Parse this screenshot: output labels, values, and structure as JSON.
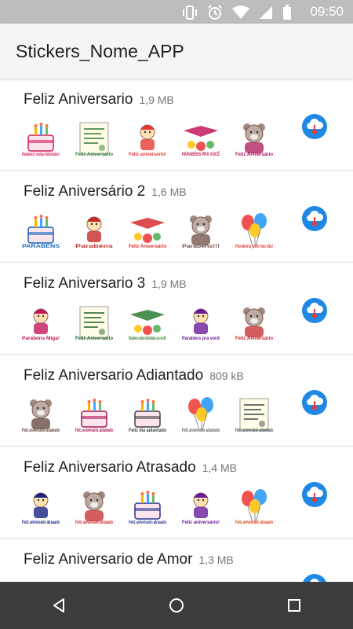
{
  "status": {
    "time": "09:50"
  },
  "app": {
    "title": "Stickers_Nome_APP"
  },
  "packs": [
    {
      "name": "Feliz Aniversario",
      "size": "1,9 MB",
      "stickers": [
        {
          "type": "cake",
          "text": "Parabéns!! muitas felicidades!",
          "color": "#d81b60"
        },
        {
          "type": "card",
          "text": "Feliz Aniversário",
          "color": "#2e7d32"
        },
        {
          "type": "character",
          "text": "Feliz aniversário!",
          "color": "#e53935"
        },
        {
          "type": "banner",
          "text": "PARABÉNS PRA VOCÊ",
          "color": "#c2185b"
        },
        {
          "type": "bear",
          "text": "Feliz Aniversário",
          "color": "#ad1457"
        }
      ]
    },
    {
      "name": "Feliz Aniversário 2",
      "size": "1,6 MB",
      "stickers": [
        {
          "type": "cake",
          "text": "PARABÉNS",
          "color": "#1565c0"
        },
        {
          "type": "character",
          "text": "Parabéns",
          "color": "#c62828"
        },
        {
          "type": "banner",
          "text": "Feliz Aniversário",
          "color": "#d32f2f"
        },
        {
          "type": "bear",
          "text": "Parabéns!!!",
          "color": "#6d4c41"
        },
        {
          "type": "balloon",
          "text": "Parabéns pelo teu dia!",
          "color": "#e53935"
        }
      ]
    },
    {
      "name": "Feliz Aniversario 3",
      "size": "1,9 MB",
      "stickers": [
        {
          "type": "character",
          "text": "Parabéns Miga!",
          "color": "#c2185b"
        },
        {
          "type": "card",
          "text": "Feliz Aniversário",
          "color": "#1b5e20"
        },
        {
          "type": "banner",
          "text": "Parabéns muitas felicidades pra você!!",
          "color": "#2e7d32"
        },
        {
          "type": "character",
          "text": "Parabéns pra você",
          "color": "#6a1b9a"
        },
        {
          "type": "bear",
          "text": "Feliz Aniversário",
          "color": "#c62828"
        }
      ]
    },
    {
      "name": "Feliz Aniversario Adiantado",
      "size": "809 kB",
      "stickers": [
        {
          "type": "bear",
          "text": "Feliz aniversário adiantado",
          "color": "#5d4037"
        },
        {
          "type": "cake",
          "text": "Feliz aniversário adiantado",
          "color": "#ad1457"
        },
        {
          "type": "cake",
          "text": "Feliz dia adiantado",
          "color": "#424242"
        },
        {
          "type": "balloon",
          "text": "Feliz aniversário adiantado",
          "color": "#616161"
        },
        {
          "type": "card",
          "text": "Feliz aniversário adiantado",
          "color": "#37474f"
        }
      ]
    },
    {
      "name": "Feliz Aniversario Atrasado",
      "size": "1,4 MB",
      "stickers": [
        {
          "type": "character",
          "text": "Feliz aniversário atrasado",
          "color": "#1a237e"
        },
        {
          "type": "bear",
          "text": "Feliz aniversário atrasado",
          "color": "#c62828"
        },
        {
          "type": "cake",
          "text": "Feliz aniversário atrasado",
          "color": "#283593"
        },
        {
          "type": "character",
          "text": "Feliz aniversário!",
          "color": "#6a1b9a"
        },
        {
          "type": "balloon",
          "text": "Feliz aniversário atrasado",
          "color": "#d84315"
        }
      ]
    },
    {
      "name": "Feliz Aniversario de Amor",
      "size": "1,3 MB",
      "stickers": [
        {
          "type": "cake",
          "text": "",
          "color": "#c62828"
        },
        {
          "type": "cake",
          "text": "",
          "color": "#ad1457"
        },
        {
          "type": "cake",
          "text": "",
          "color": "#6a1b9a"
        },
        {
          "type": "cake",
          "text": "",
          "color": "#c62828"
        },
        {
          "type": "cake",
          "text": "",
          "color": "#2e7d32"
        }
      ]
    }
  ],
  "colors": {
    "download": "#1e88e5",
    "statusbar": "#bdbdbd",
    "navbar": "#3c3c3c"
  }
}
